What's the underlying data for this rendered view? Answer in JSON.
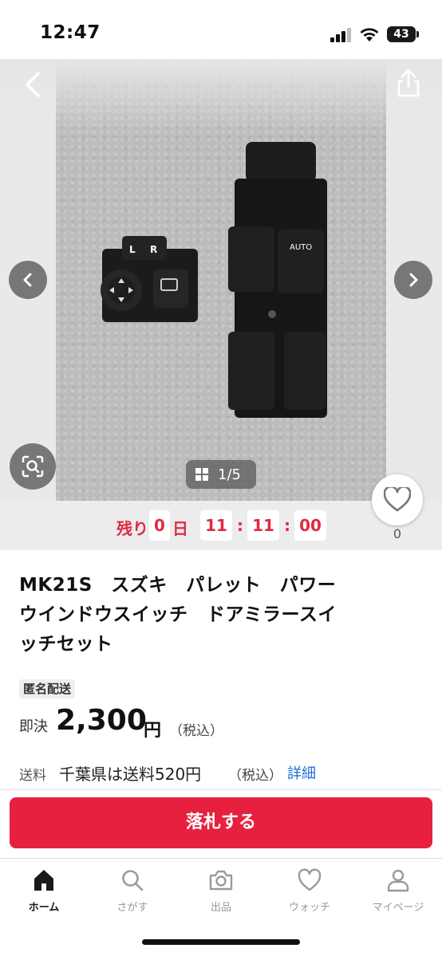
{
  "status_bar": {
    "time": "12:47",
    "battery": "43"
  },
  "gallery": {
    "counter": "1/5"
  },
  "timer": {
    "prefix": "残り",
    "days": "0",
    "days_unit": "日",
    "hours": "11",
    "minutes": "11",
    "seconds": "00",
    "separator": ":"
  },
  "watch": {
    "count": "0"
  },
  "item": {
    "title_lines": [
      "MK21S　スズキ　パレット　パワー",
      "ウインドウスイッチ　ドアミラースイ",
      "ッチセット"
    ],
    "badge": "匿名配送"
  },
  "price": {
    "label": "即決",
    "value": "2,300",
    "unit": "円",
    "tax": "（税込）"
  },
  "shipping": {
    "label": "送料",
    "value": "千葉県は送料520円",
    "tax": "（税込）",
    "detail_link": "詳細"
  },
  "action": {
    "bid_label": "落札する"
  },
  "tabbar": {
    "items": [
      {
        "label": "ホーム",
        "icon": "home-icon",
        "active": true
      },
      {
        "label": "さがす",
        "icon": "search-icon",
        "active": false
      },
      {
        "label": "出品",
        "icon": "camera-icon",
        "active": false
      },
      {
        "label": "ウォッチ",
        "icon": "heart-icon",
        "active": false
      },
      {
        "label": "マイページ",
        "icon": "person-icon",
        "active": false
      }
    ]
  },
  "colors": {
    "accent": "#e8203f",
    "timer_red": "#e02a43",
    "link_blue": "#1a6ed8"
  }
}
